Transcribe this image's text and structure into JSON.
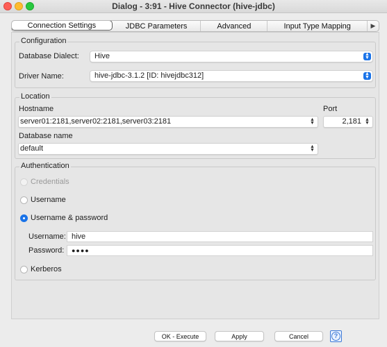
{
  "window": {
    "title": "Dialog - 3:91 - Hive Connector (hive-jdbc)"
  },
  "tabs": [
    {
      "label": "Connection Settings"
    },
    {
      "label": "JDBC Parameters"
    },
    {
      "label": "Advanced"
    },
    {
      "label": "Input Type Mapping"
    }
  ],
  "configuration": {
    "title": "Configuration",
    "dialect_label": "Database Dialect:",
    "dialect_value": "Hive",
    "driver_label": "Driver Name:",
    "driver_value": "hive-jdbc-3.1.2 [ID: hivejdbc312]"
  },
  "location": {
    "title": "Location",
    "hostname_label": "Hostname",
    "hostname_value": "server01:2181,server02:2181,server03:2181",
    "port_label": "Port",
    "port_value": "2,181",
    "dbname_label": "Database name",
    "dbname_value": "default"
  },
  "authentication": {
    "title": "Authentication",
    "options": [
      {
        "label": "Credentials",
        "enabled": false,
        "selected": false
      },
      {
        "label": "Username",
        "enabled": true,
        "selected": false
      },
      {
        "label": "Username & password",
        "enabled": true,
        "selected": true
      },
      {
        "label": "Kerberos",
        "enabled": true,
        "selected": false
      }
    ],
    "username_label": "Username:",
    "username_value": "hive",
    "password_label": "Password:",
    "password_value": "●●●●"
  },
  "buttons": {
    "ok": "OK - Execute",
    "apply": "Apply",
    "cancel": "Cancel",
    "help": "?"
  },
  "colors": {
    "accent": "#1a73e8"
  }
}
